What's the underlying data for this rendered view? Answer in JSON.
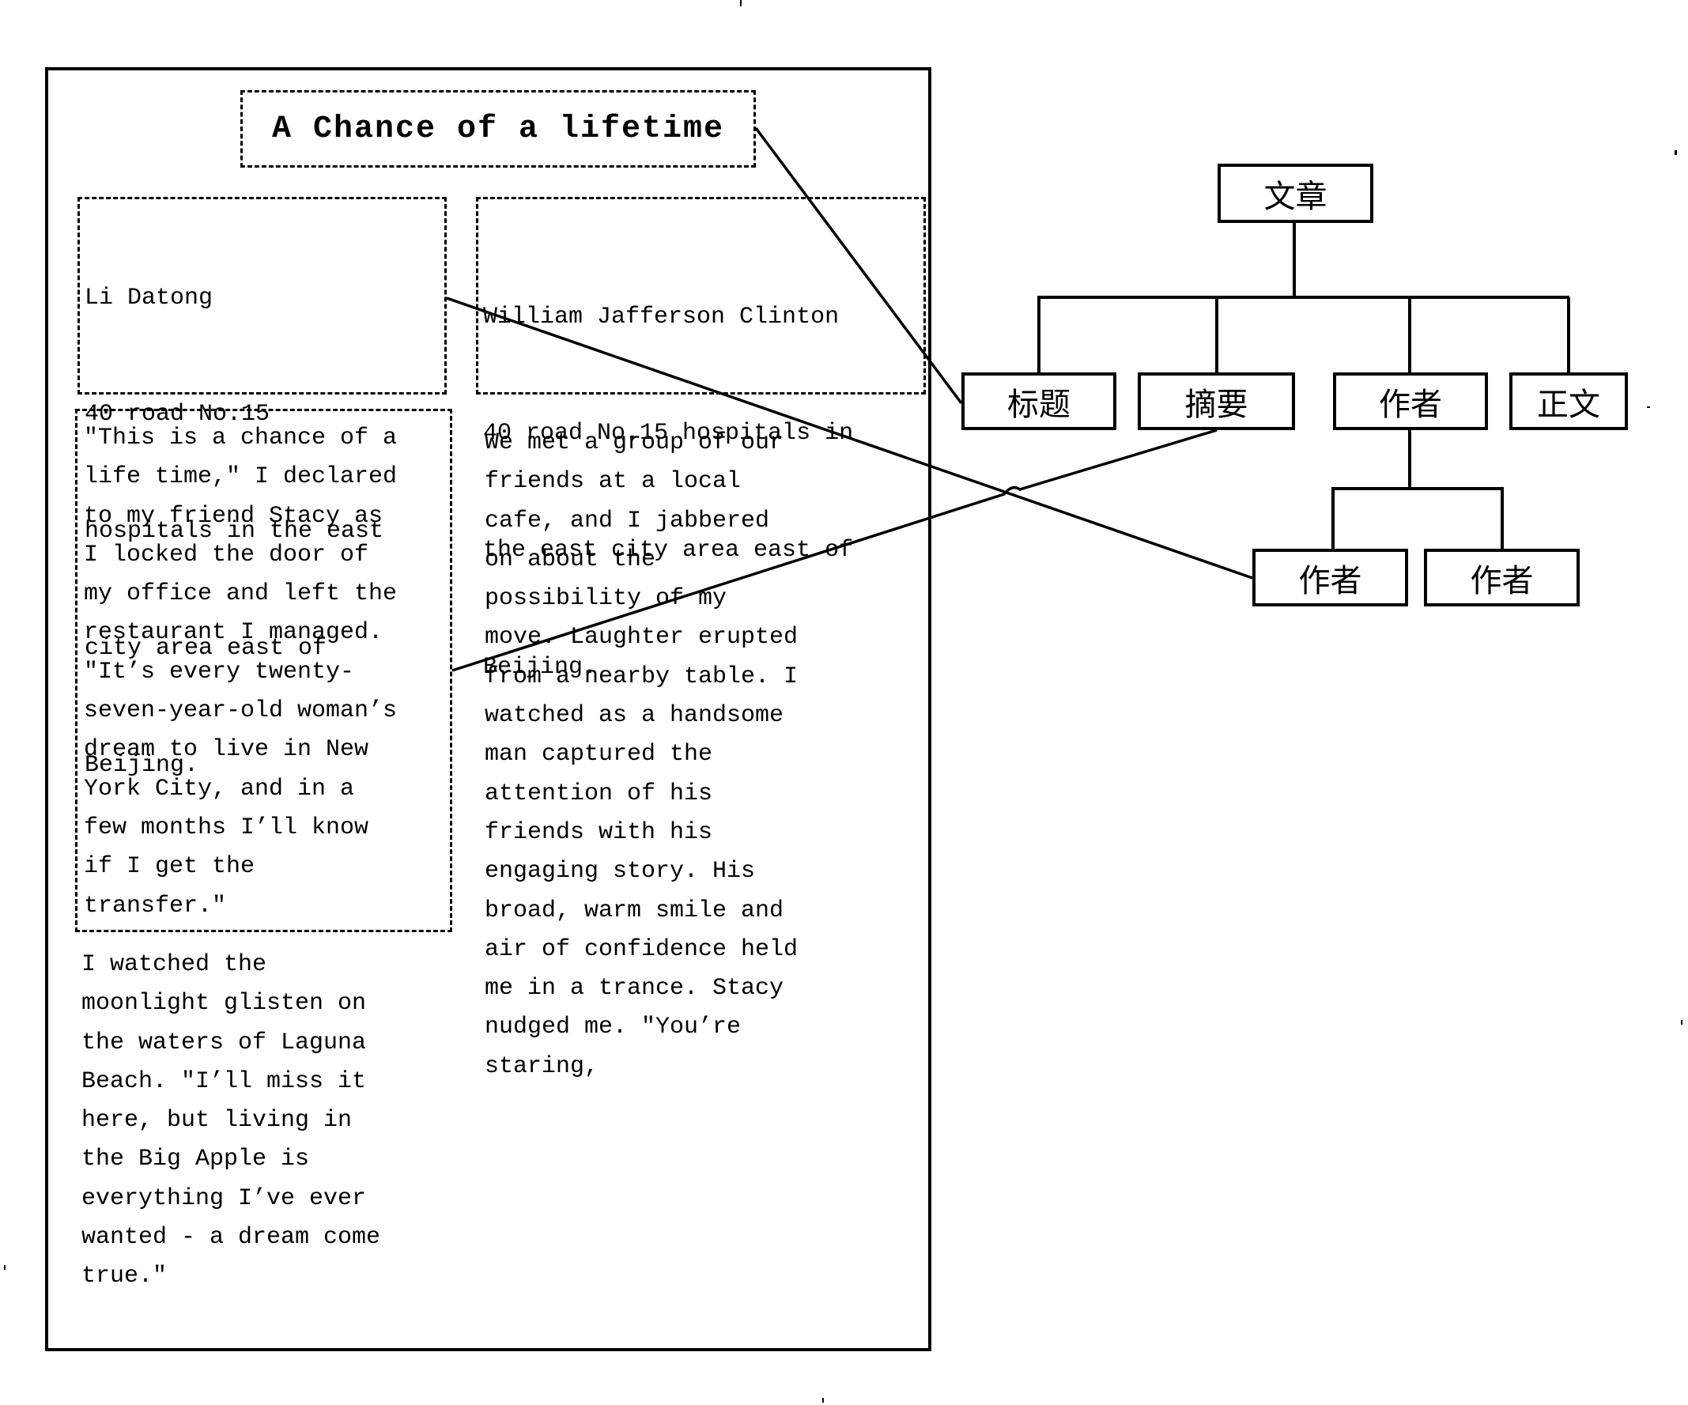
{
  "document": {
    "title": "A Chance of a lifetime",
    "authors": [
      {
        "lines": [
          "Li Datong",
          "40 road No.15",
          "hospitals in the east",
          "city area east of",
          "Beijing."
        ]
      },
      {
        "lines": [
          "William Jafferson Clinton",
          "40 road No.15 hospitals in",
          "the east city area east of",
          "Beijing."
        ]
      }
    ],
    "abstract_lines": [
      "\"This is a chance of a",
      "life time,\" I declared",
      "to my friend Stacy as",
      "I locked the door of",
      "my office and left the",
      "restaurant I managed.",
      "\"It’s every twenty-",
      "seven-year-old woman’s",
      "dream to live in New",
      "York City, and in a",
      "few months I’ll know",
      "if I get the",
      "transfer.\""
    ],
    "body_col1_lines": [
      "I watched the",
      "moonlight glisten on",
      "the waters of Laguna",
      "Beach. \"I’ll miss it",
      "here, but living in",
      "the Big Apple is",
      "everything I’ve ever",
      "wanted - a dream come",
      "true.\""
    ],
    "body_col2_lines": [
      "We met a group of our",
      "friends at a local",
      "cafe, and I jabbered",
      "on about the",
      "possibility of my",
      "move. Laughter erupted",
      "from a nearby table. I",
      "watched as a handsome",
      "man captured the",
      "attention of his",
      "friends with his",
      "engaging story. His",
      "broad, warm smile and",
      "air of confidence held",
      "me in a trance. Stacy",
      "nudged me. \"You’re",
      "staring,"
    ]
  },
  "tree": {
    "root": "文章",
    "children": [
      "标题",
      "摘要",
      "作者",
      "正文"
    ],
    "author_children": [
      "作者",
      "作者"
    ]
  },
  "mappings": [
    {
      "from": "document.title",
      "to": "标题"
    },
    {
      "from": "document.abstract",
      "to": "摘要"
    },
    {
      "from": "document.author_1",
      "to": "作者 (child 1)"
    }
  ]
}
